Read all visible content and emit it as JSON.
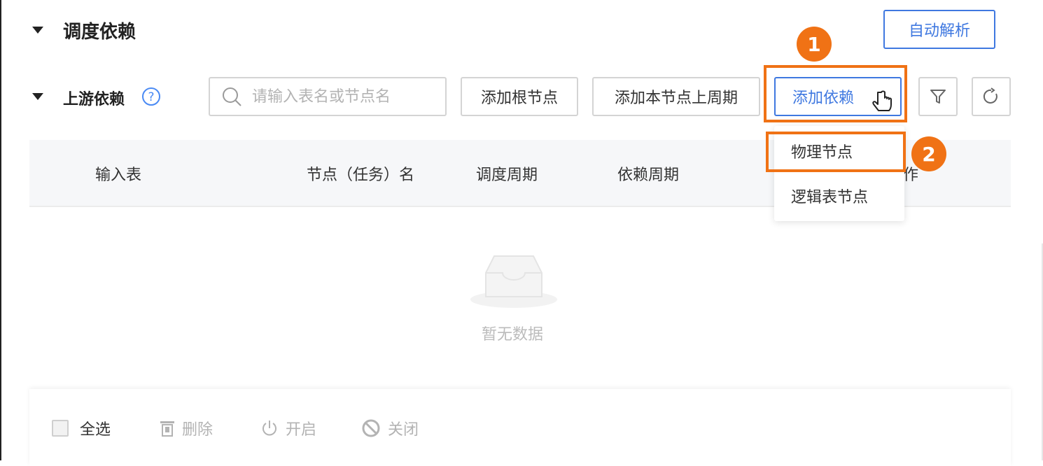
{
  "section": {
    "title": "调度依赖",
    "auto_parse_label": "自动解析"
  },
  "upstream": {
    "title": "上游依赖",
    "help_icon": "question-circle-icon"
  },
  "search": {
    "placeholder": "请输入表名或节点名"
  },
  "toolbar": {
    "add_root_label": "添加根节点",
    "add_prev_cycle_label": "添加本节点上周期",
    "add_dependency_label": "添加依赖"
  },
  "table": {
    "columns": [
      "输入表",
      "节点（任务）名",
      "调度周期",
      "依赖周期",
      "作"
    ]
  },
  "dropdown": {
    "items": [
      "物理节点",
      "逻辑表节点"
    ]
  },
  "annotations": {
    "badge1": "1",
    "badge2": "2",
    "color": "#f07215"
  },
  "empty": {
    "text": "暂无数据"
  },
  "footer": {
    "select_all": "全选",
    "delete": "删除",
    "enable": "开启",
    "close": "关闭"
  },
  "colors": {
    "primary": "#3f78e0",
    "annotation": "#f07215"
  }
}
